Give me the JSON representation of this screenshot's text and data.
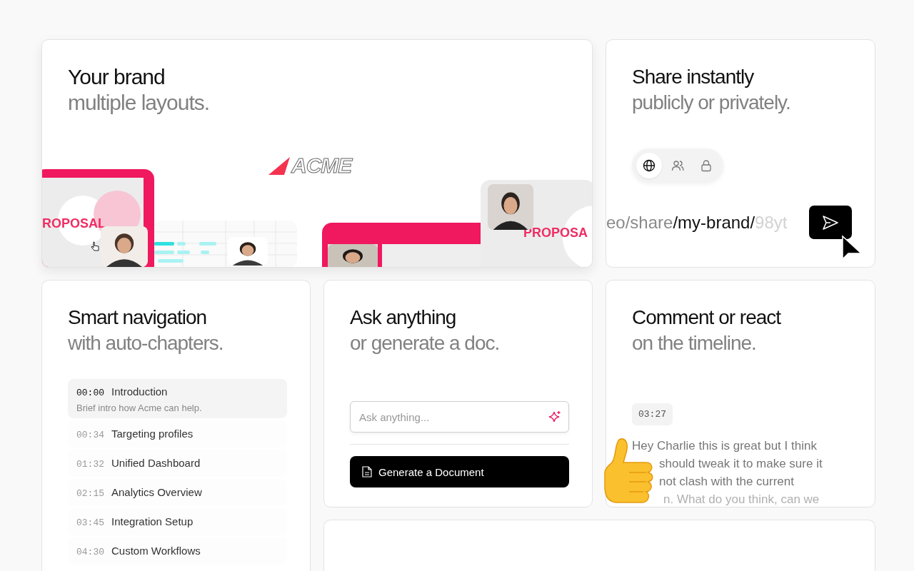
{
  "brand": {
    "title": "Your brand",
    "subtitle": "multiple layouts.",
    "logo": "ACME",
    "slide_labels": [
      "ROPOSAL",
      "PROPOSA"
    ]
  },
  "share": {
    "title": "Share instantly",
    "subtitle": "publicly or privately.",
    "visibility": [
      {
        "kind": "public",
        "selected": true
      },
      {
        "kind": "team",
        "selected": false
      },
      {
        "kind": "private",
        "selected": false
      }
    ],
    "link_parts": [
      {
        "kind": "muted",
        "text": "eo/share"
      },
      {
        "kind": "strong",
        "text": "/my-brand/"
      },
      {
        "kind": "faint",
        "text": "98yt"
      }
    ]
  },
  "chapters": {
    "title": "Smart navigation",
    "subtitle": "with auto-chapters.",
    "items": [
      {
        "time": "00:00",
        "title": "Introduction",
        "description": "Brief intro how Acme can help.",
        "selected": true
      },
      {
        "time": "00:34",
        "title": "Targeting profiles",
        "selected": false
      },
      {
        "time": "01:32",
        "title": "Unified Dashboard",
        "selected": false
      },
      {
        "time": "02:15",
        "title": "Analytics Overview",
        "selected": false
      },
      {
        "time": "03:45",
        "title": "Integration Setup",
        "selected": false
      },
      {
        "time": "04:30",
        "title": "Custom Workflows",
        "selected": false
      }
    ]
  },
  "ask": {
    "title": "Ask anything",
    "subtitle": "or generate a doc.",
    "input": {
      "placeholder": "Ask anything..."
    },
    "button": "Generate a Document"
  },
  "comment": {
    "title": "Comment or react",
    "subtitle": "on the timeline.",
    "time": "03:27",
    "lines": [
      {
        "kind": "full",
        "text": "Hey Charlie this is great but I think"
      },
      {
        "kind": "covered",
        "text": "should tweak it to make sure it"
      },
      {
        "kind": "covered",
        "text": "not clash with the current"
      },
      {
        "kind": "fading",
        "text": "n. What do you think, can we"
      }
    ]
  }
}
